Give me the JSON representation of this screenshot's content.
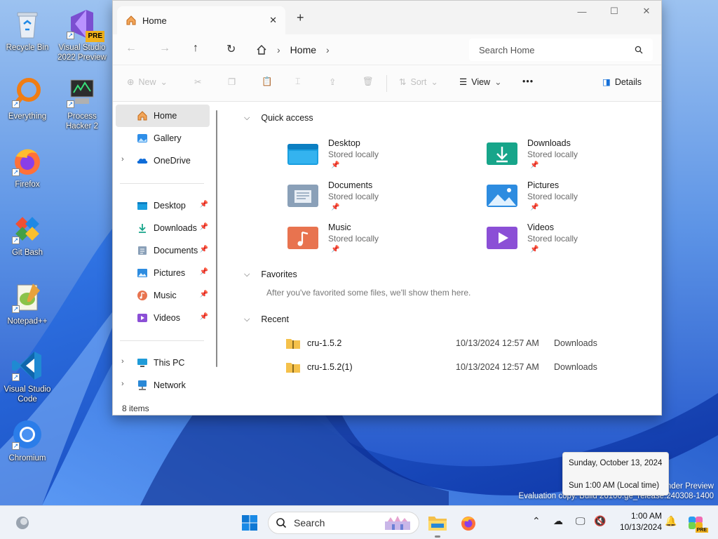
{
  "desktop": {
    "icons": [
      {
        "label": "Recycle Bin",
        "icon": "recycle-bin-icon"
      },
      {
        "label": "Visual Studio 2022 Preview",
        "icon": "visual-studio-icon",
        "badge": "PRE"
      },
      {
        "label": "Everything",
        "icon": "everything-search-icon"
      },
      {
        "label": "Process Hacker 2",
        "icon": "process-hacker-icon"
      },
      {
        "label": "Firefox",
        "icon": "firefox-icon"
      },
      {
        "label": "Git Bash",
        "icon": "git-bash-icon"
      },
      {
        "label": "Notepad++",
        "icon": "notepad-plus-plus-icon"
      },
      {
        "label": "Visual Studio Code",
        "icon": "vscode-icon"
      },
      {
        "label": "Chromium",
        "icon": "chromium-icon"
      }
    ],
    "watermark": {
      "line1": "nder Preview",
      "line2": "Evaluation copy. Build 26100.ge_release.240308-1400"
    }
  },
  "explorer": {
    "tab_title": "Home",
    "new_tab": "+",
    "window_controls": {
      "minimize": "—",
      "maximize": "☐",
      "close": "✕"
    },
    "breadcrumb": {
      "current": "Home"
    },
    "search_placeholder": "Search Home",
    "command_bar": {
      "new": "New",
      "sort": "Sort",
      "view": "View",
      "more": "•••",
      "details": "Details"
    },
    "nav_pane": {
      "top": [
        {
          "label": "Home",
          "icon": "home-icon",
          "selected": true
        },
        {
          "label": "Gallery",
          "icon": "gallery-icon"
        },
        {
          "label": "OneDrive",
          "icon": "onedrive-icon",
          "expandable": true
        }
      ],
      "pinned": [
        {
          "label": "Desktop",
          "icon": "desktop-folder-icon"
        },
        {
          "label": "Downloads",
          "icon": "downloads-icon"
        },
        {
          "label": "Documents",
          "icon": "documents-icon"
        },
        {
          "label": "Pictures",
          "icon": "pictures-icon"
        },
        {
          "label": "Music",
          "icon": "music-icon"
        },
        {
          "label": "Videos",
          "icon": "videos-icon"
        }
      ],
      "bottom": [
        {
          "label": "This PC",
          "icon": "this-pc-icon"
        },
        {
          "label": "Network",
          "icon": "network-icon"
        }
      ]
    },
    "sections": {
      "quick_access": "Quick access",
      "favorites": "Favorites",
      "favorites_empty": "After you've favorited some files, we'll show them here.",
      "recent": "Recent"
    },
    "quick_access": [
      {
        "name": "Desktop",
        "sub": "Stored locally",
        "color": "#1a9fe0"
      },
      {
        "name": "Downloads",
        "sub": "Stored locally",
        "color": "#17a58a"
      },
      {
        "name": "Documents",
        "sub": "Stored locally",
        "color": "#8aa0b8"
      },
      {
        "name": "Pictures",
        "sub": "Stored locally",
        "color": "#2d8ce0"
      },
      {
        "name": "Music",
        "sub": "Stored locally",
        "color": "#e8734f"
      },
      {
        "name": "Videos",
        "sub": "Stored locally",
        "color": "#8b4fd6"
      }
    ],
    "recent": [
      {
        "name": "cru-1.5.2",
        "date": "10/13/2024 12:57 AM",
        "location": "Downloads"
      },
      {
        "name": "cru-1.5.2(1)",
        "date": "10/13/2024 12:57 AM",
        "location": "Downloads"
      }
    ],
    "status": "8 items"
  },
  "tooltip": {
    "line1": "Sunday, October 13, 2024",
    "line2": "Sun 1:00 AM (Local time)"
  },
  "taskbar": {
    "search_label": "Search",
    "time": "1:00 AM",
    "date": "10/13/2024",
    "copilot_badge": "PRE"
  }
}
